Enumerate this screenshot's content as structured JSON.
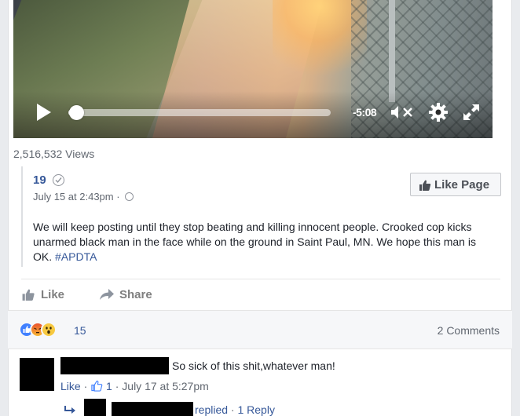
{
  "video": {
    "time_remaining": "-5:08",
    "progress": 0.03,
    "views": "2,516,532 Views",
    "icons": [
      "play-icon",
      "volume-muted-icon",
      "settings-gear-icon",
      "fullscreen-icon"
    ]
  },
  "shared_post": {
    "author": "19",
    "timestamp": "July 15 at 2:43pm",
    "separator": "·",
    "like_page_label": "Like Page",
    "body": "We will keep posting until they stop beating and killing innocent people. Crooked cop kicks unarmed black man in the face while on the ground in Saint Paul, MN. We hope this man is OK.",
    "hashtag": "#APDTA"
  },
  "actions": {
    "like": "Like",
    "share": "Share"
  },
  "reactions": {
    "types": [
      "like",
      "angry",
      "wow"
    ],
    "count": "15",
    "comments_label": "2 Comments"
  },
  "comments": [
    {
      "text": "So sick of this shit,whatever man!",
      "like_label": "Like",
      "dot": "·",
      "likes": "1",
      "time": "July 17 at 5:27pm"
    }
  ],
  "reply_line": {
    "replied_text": "replied",
    "reply_count": "1 Reply"
  },
  "colors": {
    "link": "#365899",
    "meta": "#616770",
    "like_blue": "#4080ff"
  }
}
